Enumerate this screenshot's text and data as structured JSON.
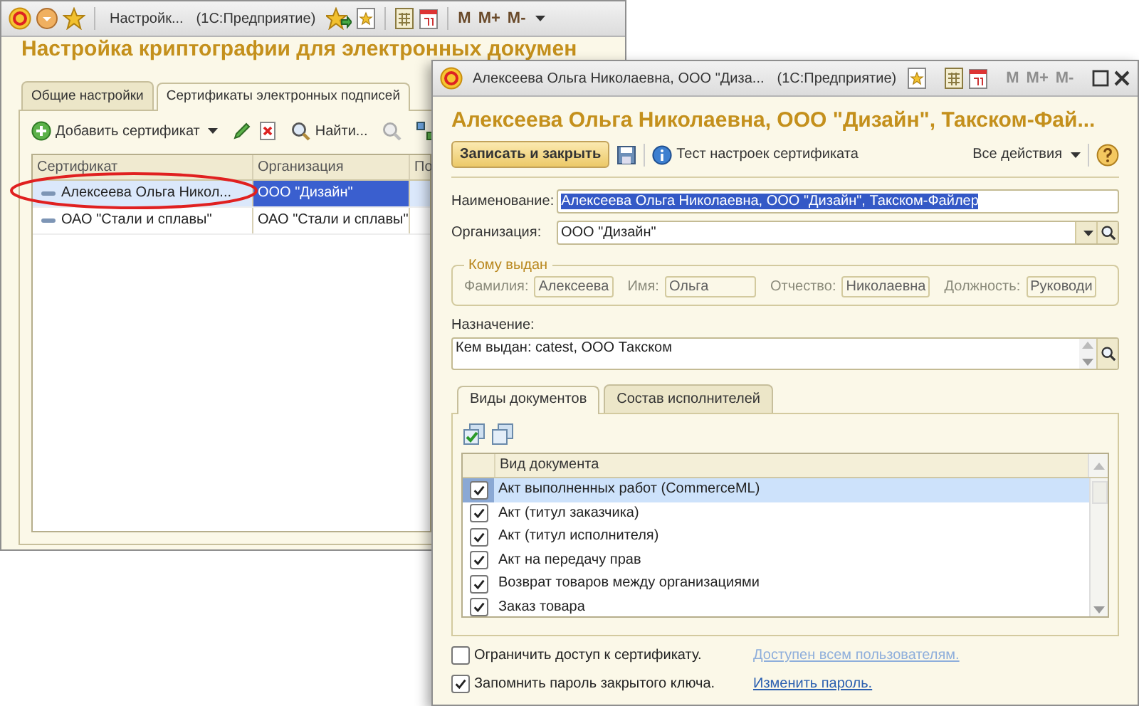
{
  "back_window": {
    "title": "Настройк...",
    "app": "(1С:Предприятие)",
    "memory_buttons": [
      "M",
      "M+",
      "M-"
    ],
    "memory_disabled": false,
    "heading": "Настройка криптографии для электронных докумен",
    "tabs": [
      {
        "label": "Общие настройки",
        "selected": false
      },
      {
        "label": "Сертификаты электронных подписей",
        "selected": true
      }
    ],
    "toolbar": {
      "add_button": "Добавить сертификат",
      "find_button": "Найти..."
    },
    "table": {
      "columns": [
        "Сертификат",
        "Организация",
        "По"
      ],
      "rows": [
        {
          "cells": [
            "Алексеева Ольга Никол...",
            "ООО \"Дизайн\""
          ],
          "selected": true
        },
        {
          "cells": [
            "ОАО \"Стали и сплавы\"",
            "ОАО \"Стали и сплавы\""
          ],
          "selected": false
        }
      ]
    }
  },
  "front_window": {
    "title": "Алексеева Ольга Николаевна, ООО \"Диза...",
    "app": "(1С:Предприятие)",
    "memory_buttons": [
      "M",
      "M+",
      "M-"
    ],
    "memory_disabled": true,
    "heading": "Алексеева Ольга Николаевна, ООО \"Дизайн\", Такском-Фай...",
    "toolbar": {
      "primary_button": "Записать и закрыть",
      "test_button": "Тест настроек сертификата",
      "all_actions": "Все действия"
    },
    "name_field": {
      "label": "Наименование:",
      "value": "Алексеева Ольга Николаевна, ООО \"Дизайн\", Такском-Файлер",
      "text_selected": true
    },
    "organization_field": {
      "label": "Организация:",
      "value": "ООО \"Дизайн\""
    },
    "issued_to": {
      "title": "Кому выдан",
      "disabled": true,
      "fields": [
        {
          "label": "Фамилия:",
          "value": "Алексеева"
        },
        {
          "label": "Имя:",
          "value": "Ольга"
        },
        {
          "label": "Отчество:",
          "value": "Николаевна"
        },
        {
          "label": "Должность:",
          "value": "Руководи"
        }
      ]
    },
    "purpose": {
      "label": "Назначение:",
      "value": "Кем выдан: catest, ООО Такском"
    },
    "tabs": [
      {
        "label": "Виды документов",
        "selected": true
      },
      {
        "label": "Состав исполнителей",
        "selected": false
      }
    ],
    "doc_table": {
      "column": "Вид документа",
      "rows": [
        {
          "label": "Акт выполненных работ (CommerceML)",
          "checked": true,
          "selected": true
        },
        {
          "label": "Акт (титул заказчика)",
          "checked": true,
          "selected": false
        },
        {
          "label": "Акт (титул исполнителя)",
          "checked": true,
          "selected": false
        },
        {
          "label": "Акт на передачу прав",
          "checked": true,
          "selected": false
        },
        {
          "label": "Возврат товаров между организациями",
          "checked": true,
          "selected": false
        },
        {
          "label": "Заказ товара",
          "checked": true,
          "selected": false
        }
      ]
    },
    "options": [
      {
        "label": "Ограничить доступ к сертификату.",
        "checked": false,
        "link": "Доступен всем пользователям.",
        "link_disabled": true
      },
      {
        "label": "Запомнить пароль закрытого ключа.",
        "checked": true,
        "link": "Изменить пароль.",
        "link_disabled": false
      }
    ]
  }
}
